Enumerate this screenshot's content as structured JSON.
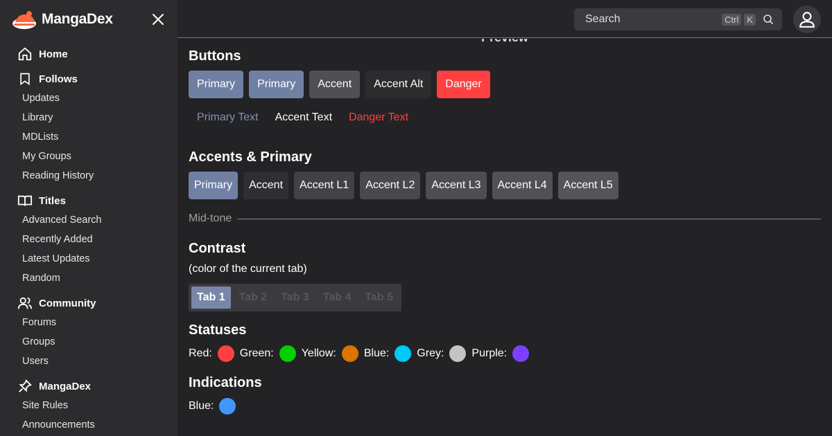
{
  "colors": {
    "primary": "#6d7fa1",
    "accent": "#4f4f55",
    "danger": "#ff4040",
    "sidebar_bg": "#2c2c2f",
    "main_bg": "#232325"
  },
  "brand": {
    "name": "MangaDex"
  },
  "sidebar": {
    "groups": [
      {
        "label": "Home",
        "icon": "home-icon",
        "items": []
      },
      {
        "label": "Follows",
        "icon": "bookmark-icon",
        "items": [
          "Updates",
          "Library",
          "MDLists",
          "My Groups",
          "Reading History"
        ]
      },
      {
        "label": "Titles",
        "icon": "book-icon",
        "items": [
          "Advanced Search",
          "Recently Added",
          "Latest Updates",
          "Random"
        ]
      },
      {
        "label": "Community",
        "icon": "users-icon",
        "items": [
          "Forums",
          "Groups",
          "Users"
        ]
      },
      {
        "label": "MangaDex",
        "icon": "pin-icon",
        "items": [
          "Site Rules",
          "Announcements"
        ]
      }
    ]
  },
  "topbar": {
    "search_label": "Search",
    "kbd_ctrl": "Ctrl",
    "kbd_k": "K"
  },
  "main": {
    "preview_title": "Preview",
    "buttons_heading": "Buttons",
    "buttons": [
      {
        "label": "Primary",
        "bg": "#7080a3",
        "fg": "#ffffff"
      },
      {
        "label": "Primary",
        "bg": "#7080a3",
        "fg": "#ffffff"
      },
      {
        "label": "Accent",
        "bg": "#4f4f55",
        "fg": "#ffffff"
      },
      {
        "label": "Accent Alt",
        "bg": "#2c2c2f",
        "fg": "#ffffff"
      },
      {
        "label": "Danger",
        "bg": "#ff4040",
        "fg": "#ffffff"
      }
    ],
    "text_buttons": [
      {
        "label": "Primary Text",
        "fg": "#8391b3"
      },
      {
        "label": "Accent Text",
        "fg": "#ffffff"
      },
      {
        "label": "Danger Text",
        "fg": "#ff4040"
      }
    ],
    "accents_heading": "Accents & Primary",
    "accents": [
      {
        "label": "Primary",
        "bg": "#7080a3"
      },
      {
        "label": "Accent",
        "bg": "#2f2f33"
      },
      {
        "label": "Accent L1",
        "bg": "#414147"
      },
      {
        "label": "Accent L2",
        "bg": "#48484e"
      },
      {
        "label": "Accent L3",
        "bg": "#4d4d53"
      },
      {
        "label": "Accent L4",
        "bg": "#505056"
      },
      {
        "label": "Accent L5",
        "bg": "#545459"
      }
    ],
    "midtone_label": "Mid-tone",
    "contrast_heading": "Contrast",
    "contrast_note": "(color of the current tab)",
    "tabs": [
      "Tab 1",
      "Tab 2",
      "Tab 3",
      "Tab 4",
      "Tab 5"
    ],
    "statuses_heading": "Statuses",
    "statuses": [
      {
        "label": "Red:",
        "color": "#ff4040"
      },
      {
        "label": "Green:",
        "color": "#04d000"
      },
      {
        "label": "Yellow:",
        "color": "#da7500"
      },
      {
        "label": "Blue:",
        "color": "#00c9f5"
      },
      {
        "label": "Grey:",
        "color": "#c4c4c4"
      },
      {
        "label": "Purple:",
        "color": "#7b40ff"
      }
    ],
    "indications_heading": "Indications",
    "indications": [
      {
        "label": "Blue:",
        "color": "#4098ff"
      }
    ]
  }
}
